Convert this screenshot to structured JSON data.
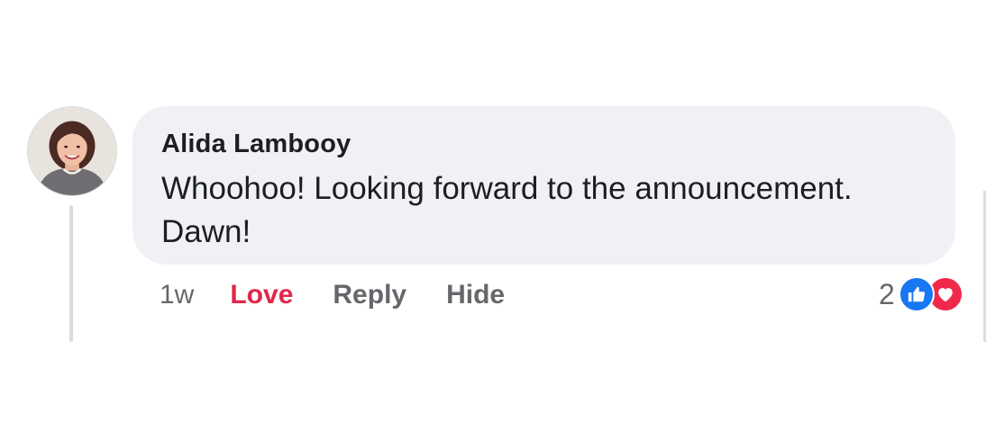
{
  "comment": {
    "author": "Alida Lambooy",
    "text": "Whoohoo! Looking forward to the announcement.\nDawn!",
    "avatar_icon": "profile-photo"
  },
  "actions": {
    "timestamp": "1w",
    "love_label": "Love",
    "reply_label": "Reply",
    "hide_label": "Hide"
  },
  "reactions": {
    "count": "2",
    "types": [
      "like-icon",
      "love-icon"
    ],
    "colors": {
      "like": "#1877f2",
      "love": "#f0284a"
    }
  },
  "colors": {
    "bubble": "#f0f1f4",
    "love_action": "#e0264a",
    "muted_text": "#65676b",
    "primary_text": "#1c1e21"
  }
}
